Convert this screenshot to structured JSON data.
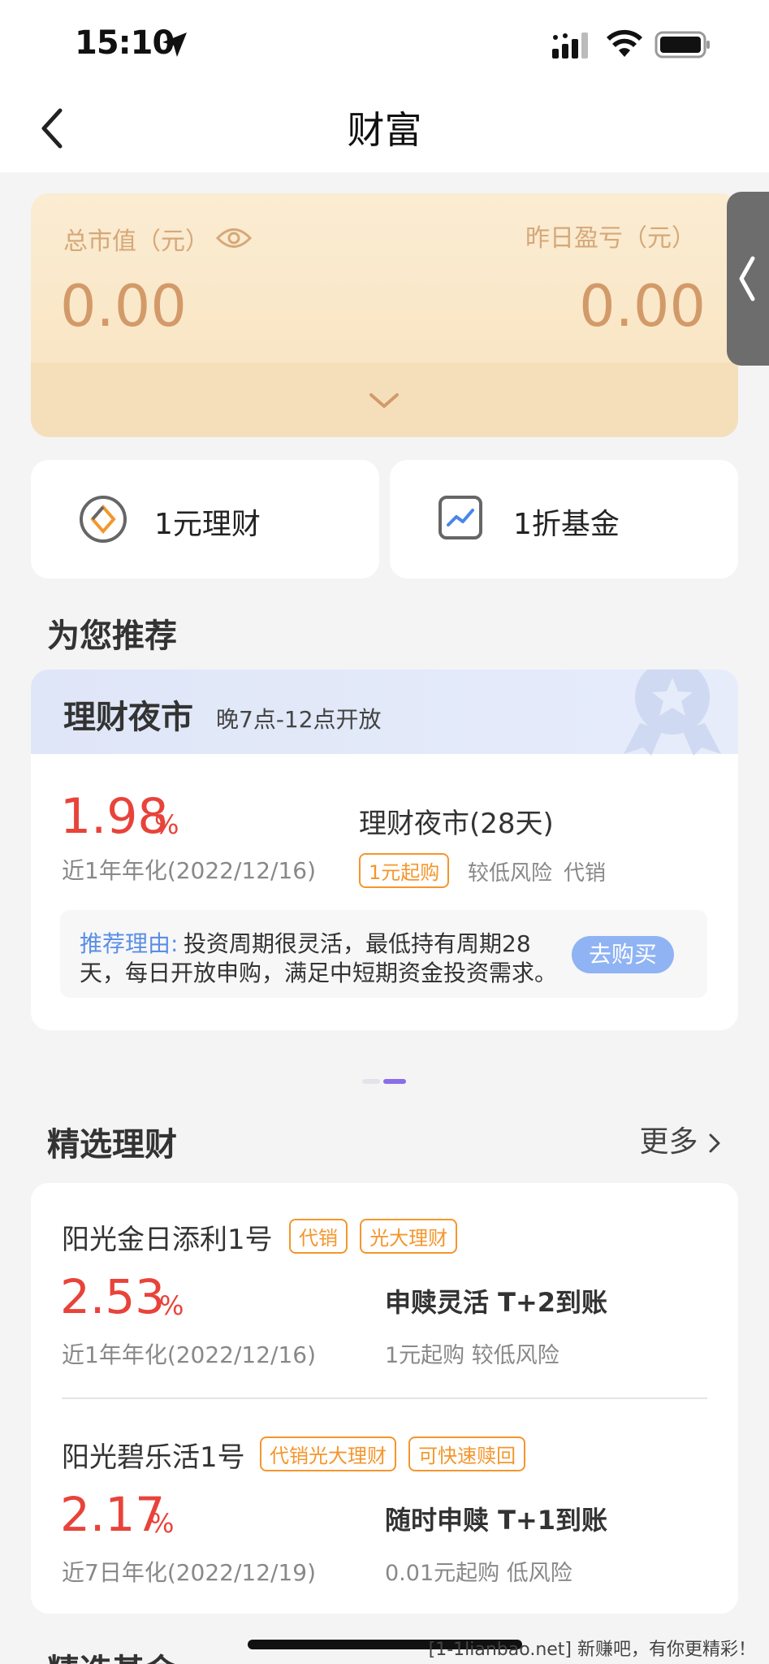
{
  "status_bar": {
    "time": "15:10"
  },
  "nav": {
    "title": "财富"
  },
  "wealth": {
    "total_label": "总市值（元）",
    "total_value": "0.00",
    "yesterday_label": "昨日盈亏（元）",
    "yesterday_value": "0.00"
  },
  "quick": [
    {
      "label": "1元理财",
      "icon": "coin-icon"
    },
    {
      "label": "1折基金",
      "icon": "chart-icon"
    }
  ],
  "recommend": {
    "section_title": "为您推荐",
    "header_title": "理财夜市",
    "header_sub": "晚7点-12点开放",
    "rate": "1.98",
    "rate_unit": "%",
    "rate_desc": "近1年年化(2022/12/16)",
    "product": "理财夜市(28天)",
    "tag": "1元起购",
    "risk": "较低风险",
    "dist": "代销",
    "reason_label": "推荐理由:",
    "reason_line1": "投资周期很灵活，最低持有周期28",
    "reason_line2": "天，每日开放申购，满足中短期资金投资需求。",
    "buy": "去购买"
  },
  "featured": {
    "section_title": "精选理财",
    "more": "更多",
    "items": [
      {
        "name": "阳光金日添利1号",
        "tags": [
          "代销",
          "光大理财"
        ],
        "rate": "2.53",
        "unit": "%",
        "desc": "近1年年化(2022/12/16)",
        "feature": "申赎灵活 T+2到账",
        "sub": "1元起购 较低风险"
      },
      {
        "name": "阳光碧乐活1号",
        "tags": [
          "代销光大理财",
          "可快速赎回"
        ],
        "rate": "2.17",
        "unit": "%",
        "desc": "近7日年化(2022/12/19)",
        "feature": "随时申赎 T+1到账",
        "sub": "0.01元起购 低风险"
      }
    ]
  },
  "next_section": {
    "title": "精选基金"
  },
  "watermark": "[1-1lianbao.net] 新赚吧，有你更精彩！"
}
